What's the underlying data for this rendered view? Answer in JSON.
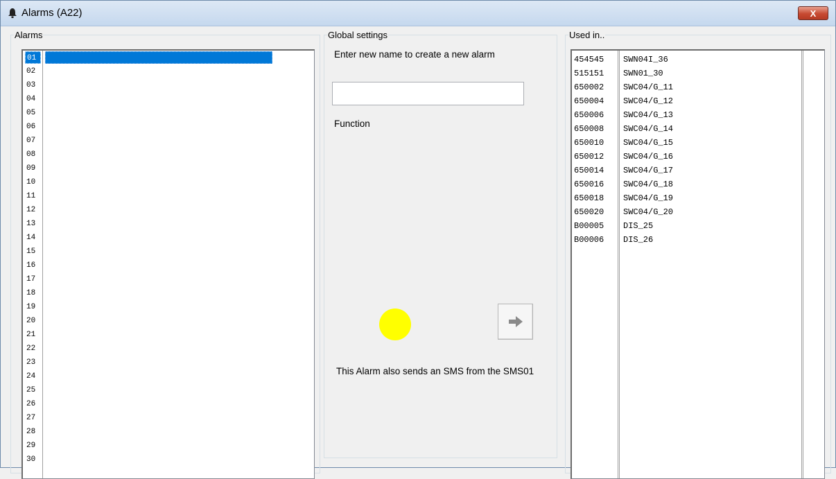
{
  "window": {
    "title": "Alarms (A22)",
    "title_icon": "bell-icon",
    "close_label": "X"
  },
  "alarms_group": {
    "legend": "Alarms",
    "selected_index": 0,
    "items": [
      "01",
      "02",
      "03",
      "04",
      "05",
      "06",
      "07",
      "08",
      "09",
      "10",
      "11",
      "12",
      "13",
      "14",
      "15",
      "16",
      "17",
      "18",
      "19",
      "20",
      "21",
      "22",
      "23",
      "24",
      "25",
      "26",
      "27",
      "28",
      "29",
      "30"
    ]
  },
  "global_settings": {
    "legend": "Global settings",
    "hint": "Enter new name to create a new alarm",
    "name_input": {
      "value": "",
      "placeholder": ""
    },
    "function_label": "Function",
    "status_led_color": "#ffff00",
    "apply_icon": "arrow-right-icon",
    "sms_note": "This Alarm also sends an SMS from the SMS01"
  },
  "used_in": {
    "legend": "Used in..",
    "rows": [
      {
        "id": "454545",
        "name": "SWN04I_36"
      },
      {
        "id": "515151",
        "name": "SWN01_30"
      },
      {
        "id": "650002",
        "name": "SWC04/G_11"
      },
      {
        "id": "650004",
        "name": "SWC04/G_12"
      },
      {
        "id": "650006",
        "name": "SWC04/G_13"
      },
      {
        "id": "650008",
        "name": "SWC04/G_14"
      },
      {
        "id": "650010",
        "name": "SWC04/G_15"
      },
      {
        "id": "650012",
        "name": "SWC04/G_16"
      },
      {
        "id": "650014",
        "name": "SWC04/G_17"
      },
      {
        "id": "650016",
        "name": "SWC04/G_18"
      },
      {
        "id": "650018",
        "name": "SWC04/G_19"
      },
      {
        "id": "650020",
        "name": "SWC04/G_20"
      },
      {
        "id": "B00005",
        "name": "DIS_25"
      },
      {
        "id": "B00006",
        "name": "DIS_26"
      }
    ]
  },
  "colors": {
    "selection": "#0078d7",
    "led": "#ffff00",
    "close_button": "#c74a32"
  }
}
